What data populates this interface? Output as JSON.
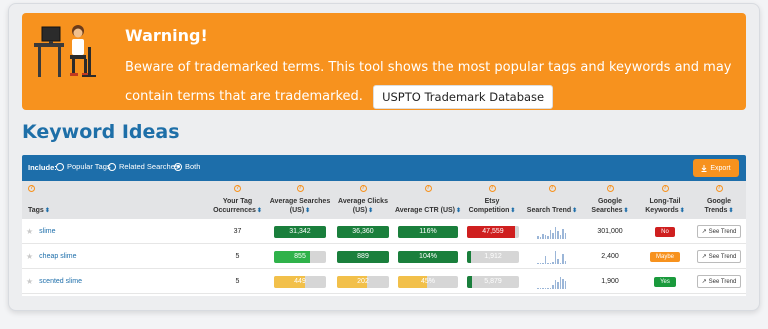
{
  "warning": {
    "title": "Warning!",
    "text": "Beware of trademarked terms. This tool shows the most popular tags and keywords and may contain terms that are trademarked.",
    "button_label": "USPTO Trademark Database"
  },
  "section_title": "Keyword Ideas",
  "toolbar": {
    "include_label": "Include:",
    "options": [
      "Popular Tags",
      "Related Searches",
      "Both"
    ],
    "selected": "Both",
    "export_label": "Export"
  },
  "columns": [
    {
      "label": "Tags"
    },
    {
      "label": "Your Tag Occurrences"
    },
    {
      "label": "Average Searches (US)"
    },
    {
      "label": "Average Clicks (US)"
    },
    {
      "label": "Average CTR (US)"
    },
    {
      "label": "Etsy Competition"
    },
    {
      "label": "Search Trend"
    },
    {
      "label": "Google Searches"
    },
    {
      "label": "Long-Tail Keywords"
    },
    {
      "label": "Google Trends"
    }
  ],
  "rows": [
    {
      "tag": "slime",
      "occurrences": "37",
      "avg_searches": "31,342",
      "avg_clicks": "36,360",
      "avg_ctr": "116%",
      "competition": "47,559",
      "google_searches": "301,000",
      "long_tail": "No",
      "trend_label": "See Trend"
    },
    {
      "tag": "cheap slime",
      "occurrences": "5",
      "avg_searches": "855",
      "avg_clicks": "889",
      "avg_ctr": "104%",
      "competition": "1,912",
      "google_searches": "2,400",
      "long_tail": "Maybe",
      "trend_label": "See Trend"
    },
    {
      "tag": "scented slime",
      "occurrences": "5",
      "avg_searches": "449",
      "avg_clicks": "202",
      "avg_ctr": "45%",
      "competition": "5,879",
      "google_searches": "1,900",
      "long_tail": "Yes",
      "trend_label": "See Trend"
    }
  ],
  "colors": {
    "accent_orange": "#f7921e",
    "brand_blue": "#1d6eaa",
    "green_dark": "#1a7f3c",
    "green_light": "#2fb24a",
    "yellow": "#f2c04a",
    "red": "#cf1f1f"
  }
}
